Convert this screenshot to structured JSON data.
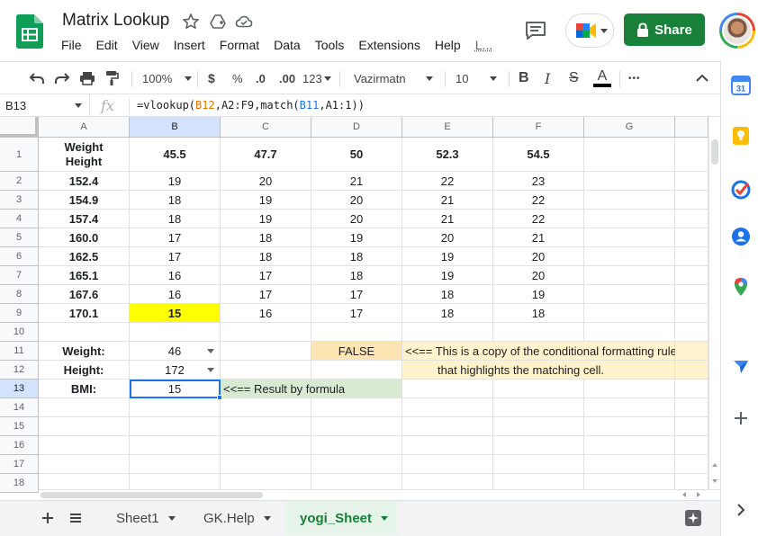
{
  "app": {
    "doc_title": "Matrix Lookup",
    "menu": [
      "File",
      "Edit",
      "View",
      "Insert",
      "Format",
      "Data",
      "Tools",
      "Extensions",
      "Help",
      "L..."
    ],
    "share_label": "Share"
  },
  "toolbar": {
    "zoom": "100%",
    "currency": "$",
    "percent": "%",
    "decrease_decimals": ".0",
    "increase_decimals": ".00",
    "more_formats": "123",
    "font": "Vazirmatn",
    "font_size": "10",
    "bold": "B",
    "italic": "I",
    "strikethrough": "S",
    "text_color": "A",
    "more": "•••",
    "text_color_value": "#000000"
  },
  "formula_bar": {
    "name_box": "B13",
    "fx": "fx",
    "formula": {
      "p1": "=vlookup(",
      "r1": "B12",
      "p2": ",",
      "r2": "A2:F9",
      "p3": ",match(",
      "r3": "B11",
      "p4": ",",
      "r4": "A1:1",
      "p5": "))"
    }
  },
  "columns": [
    "A",
    "B",
    "C",
    "D",
    "E",
    "F",
    "G"
  ],
  "rows": [
    "1",
    "2",
    "3",
    "4",
    "5",
    "6",
    "7",
    "8",
    "9",
    "10",
    "11",
    "12",
    "13",
    "14",
    "15",
    "16",
    "17",
    "18"
  ],
  "table": {
    "corner_line1": "Weight",
    "corner_line2": "Height",
    "weights": [
      "45.5",
      "47.7",
      "50",
      "52.3",
      "54.5"
    ],
    "heights": [
      "152.4",
      "154.9",
      "157.4",
      "160.0",
      "162.5",
      "165.1",
      "167.6",
      "170.1"
    ],
    "values": [
      [
        "19",
        "20",
        "21",
        "22",
        "23"
      ],
      [
        "18",
        "19",
        "20",
        "21",
        "22"
      ],
      [
        "18",
        "19",
        "20",
        "21",
        "22"
      ],
      [
        "17",
        "18",
        "19",
        "20",
        "21"
      ],
      [
        "17",
        "18",
        "18",
        "19",
        "20"
      ],
      [
        "16",
        "17",
        "18",
        "19",
        "20"
      ],
      [
        "16",
        "17",
        "17",
        "18",
        "19"
      ],
      [
        "15",
        "16",
        "17",
        "18",
        "18"
      ]
    ]
  },
  "inputs": {
    "weight_label": "Weight:",
    "weight_value": "46",
    "height_label": "Height:",
    "height_value": "172",
    "bmi_label": "BMI:",
    "bmi_value": "15",
    "result_note": "<<== Result by formula"
  },
  "cf_copy": {
    "value": "FALSE",
    "note_line1": "<<== This is a copy of the conditional formatting rule",
    "note_line2": "that highlights the matching cell."
  },
  "colors": {
    "highlight": "#ffff00",
    "false_cell": "#fce5b3",
    "note_bg": "#fff2cc",
    "result_bg": "#d9ead3",
    "share_green": "#188038",
    "active_tab": "#188038"
  },
  "sheets": {
    "tabs": [
      "Sheet1",
      "GK.Help",
      "yogi_Sheet"
    ],
    "active": "yogi_Sheet"
  }
}
